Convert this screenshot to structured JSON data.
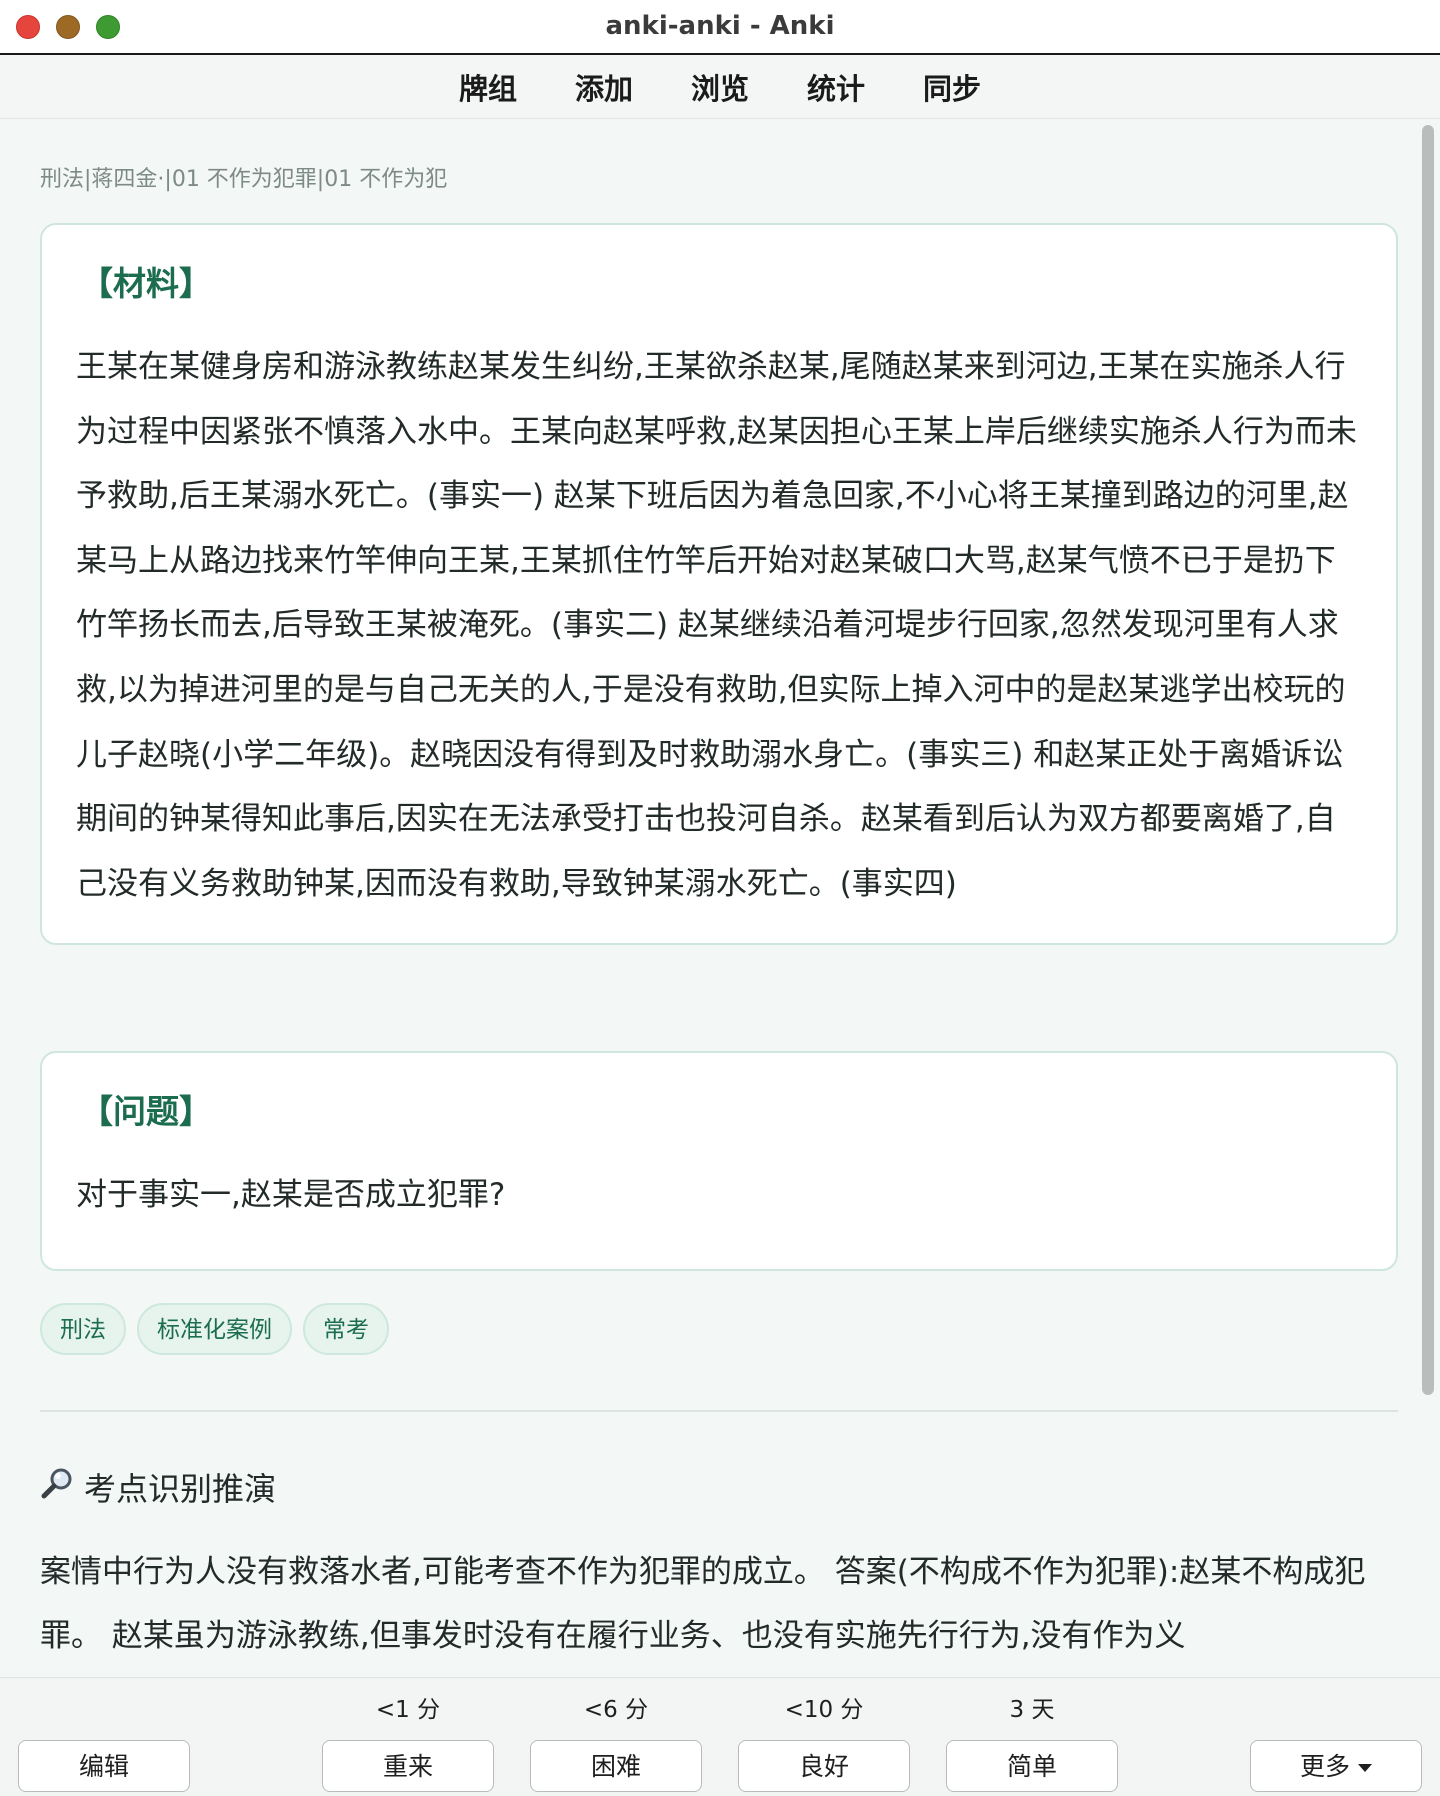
{
  "window": {
    "title": "anki-anki - Anki"
  },
  "toolbar": {
    "items": [
      "牌组",
      "添加",
      "浏览",
      "统计",
      "同步"
    ]
  },
  "card": {
    "deck_path": "刑法|蒋四金·|01 不作为犯罪|01 不作为犯",
    "material_heading": "【材料】",
    "material_text": "王某在某健身房和游泳教练赵某发生纠纷,王某欲杀赵某,尾随赵某来到河边,王某在实施杀人行为过程中因紧张不慎落入水中。王某向赵某呼救,赵某因担心王某上岸后继续实施杀人行为而未予救助,后王某溺水死亡。(事实一) 赵某下班后因为着急回家,不小心将王某撞到路边的河里,赵某马上从路边找来竹竿伸向王某,王某抓住竹竿后开始对赵某破口大骂,赵某气愤不已于是扔下竹竿扬长而去,后导致王某被淹死。(事实二) 赵某继续沿着河堤步行回家,忽然发现河里有人求救,以为掉进河里的是与自己无关的人,于是没有救助,但实际上掉入河中的是赵某逃学出校玩的儿子赵晓(小学二年级)。赵晓因没有得到及时救助溺水身亡。(事实三) 和赵某正处于离婚诉讼期间的钟某得知此事后,因实在无法承受打击也投河自杀。赵某看到后认为双方都要离婚了,自己没有义务救助钟某,因而没有救助,导致钟某溺水死亡。(事实四)",
    "question_heading": "【问题】",
    "question_text": "对于事实一,赵某是否成立犯罪?",
    "tags": [
      "刑法",
      "标准化案例",
      "常考"
    ],
    "analysis_heading": "考点识别推演",
    "analysis_icon": "magnifier-icon",
    "analysis_text": "案情中行为人没有救落水者,可能考查不作为犯罪的成立。 答案(不构成不作为犯罪):赵某不构成犯罪。 赵某虽为游泳教练,但事发时没有在履行业务、也没有实施先行行为,没有作为义"
  },
  "bottom_bar": {
    "edit_label": "编辑",
    "answers": [
      {
        "time": "<1 分",
        "label": "重来"
      },
      {
        "time": "<6 分",
        "label": "困难"
      },
      {
        "time": "<10 分",
        "label": "良好"
      },
      {
        "time": "3 天",
        "label": "简单"
      }
    ],
    "more_label": "更多"
  },
  "colors": {
    "accent": "#1c6d4f",
    "card_border": "#cfe6de",
    "tag_background": "#e6f4ed",
    "main_background": "#f3f7f6",
    "close_button": "#e5453c",
    "minimize_button": "#9c6a25",
    "zoom_button": "#3d9b32"
  }
}
